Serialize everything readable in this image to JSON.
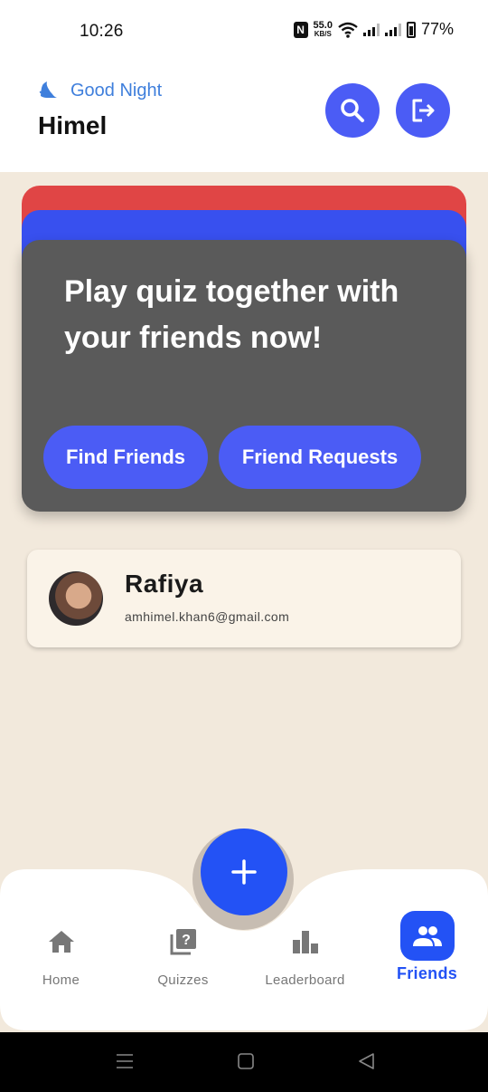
{
  "status_bar": {
    "time": "10:26",
    "speed_value": "55.0",
    "speed_unit": "KB/S",
    "battery": "77%",
    "icons": [
      "nfc-icon",
      "wifi-icon",
      "signal-icon",
      "signal-icon",
      "battery-icon"
    ]
  },
  "header": {
    "greeting": "Good Night",
    "greeting_icon": "moon-icon",
    "username": "Himel",
    "actions": [
      "search-icon",
      "logout-icon"
    ]
  },
  "promo_card": {
    "title": "Play quiz together with your friends now!",
    "find_friends_label": "Find Friends",
    "friend_requests_label": "Friend Requests"
  },
  "friends": [
    {
      "name": "Rafiya",
      "email": "amhimel.khan6@gmail.com"
    }
  ],
  "fab": {
    "icon": "plus-icon"
  },
  "bottom_nav": {
    "items": [
      {
        "label": "Home",
        "icon": "home-icon"
      },
      {
        "label": "Quizzes",
        "icon": "quiz-icon"
      },
      {
        "label": "Leaderboard",
        "icon": "leaderboard-icon"
      },
      {
        "label": "Friends",
        "icon": "friends-icon",
        "active": true
      }
    ]
  },
  "colors": {
    "accent": "#4b5cf5",
    "primary": "#2352f5",
    "greeting": "#3f7fdc",
    "background": "#f2e9dc",
    "card": "#5a5a5a",
    "stack_red": "#e04545",
    "stack_blue": "#3850ef"
  }
}
